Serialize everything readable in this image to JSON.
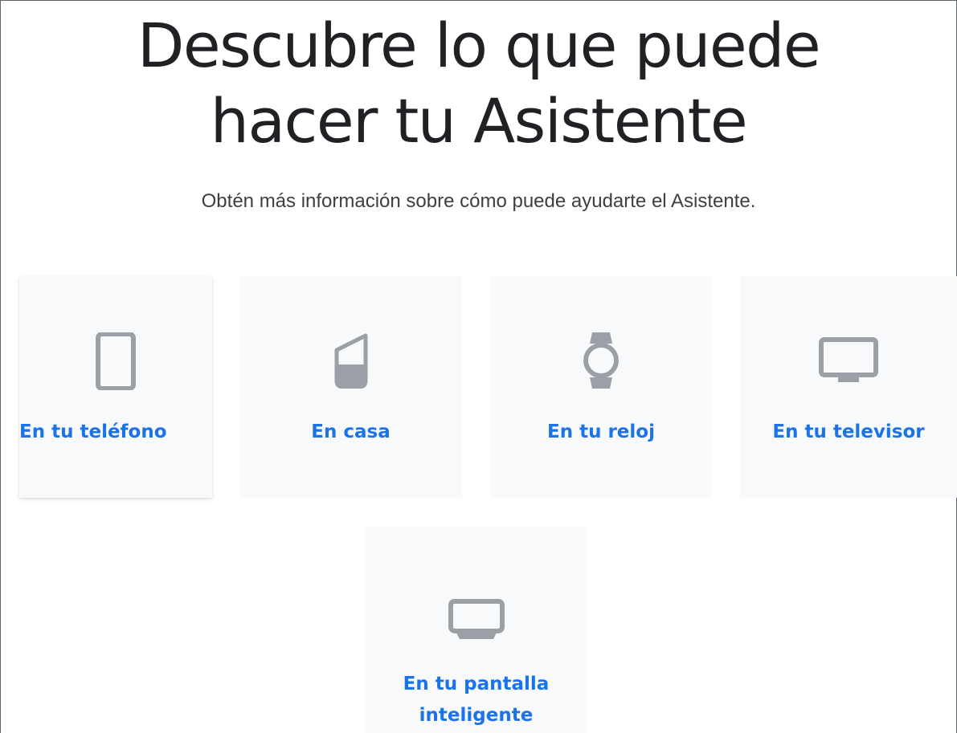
{
  "page": {
    "title_line1": "Descubre lo que puede",
    "title_line2": "hacer tu Asistente",
    "subtitle": "Obtén más información sobre cómo puede ayudarte el Asistente."
  },
  "cards": [
    {
      "label": "En tu teléfono",
      "icon": "phone-icon"
    },
    {
      "label": "En casa",
      "icon": "smart-speaker-icon"
    },
    {
      "label": "En tu reloj",
      "icon": "smartwatch-icon"
    },
    {
      "label": "En tu televisor",
      "icon": "tv-icon"
    },
    {
      "label_line1": "En tu pantalla",
      "label_line2": "inteligente",
      "icon": "smart-display-icon"
    }
  ],
  "colors": {
    "link": "#1a73e8",
    "card_bg": "#f8f9fa",
    "icon_gray": "#9aa0a6",
    "title": "#202124"
  }
}
